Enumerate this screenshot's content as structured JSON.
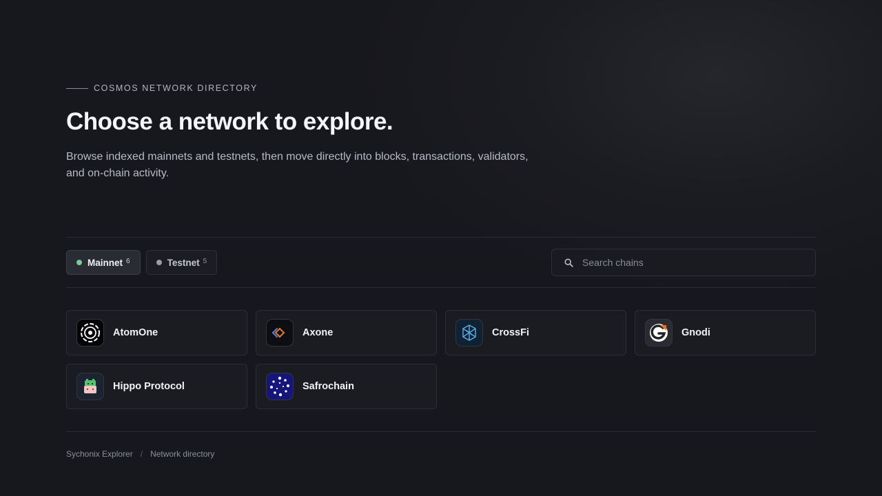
{
  "header": {
    "eyebrow": "COSMOS NETWORK DIRECTORY",
    "title": "Choose a network to explore.",
    "description": "Browse indexed mainnets and testnets, then move directly into blocks, transactions, validators, and on-chain activity."
  },
  "tabs": [
    {
      "label": "Mainnet",
      "count": "6",
      "dot_color": "#7fc79a",
      "active": true
    },
    {
      "label": "Testnet",
      "count": "5",
      "dot_color": "#9a9dae",
      "active": false
    }
  ],
  "search": {
    "placeholder": "Search chains",
    "value": ""
  },
  "chains": [
    {
      "name": "AtomOne",
      "icon": "atomone-logo-icon"
    },
    {
      "name": "Axone",
      "icon": "axone-logo-icon"
    },
    {
      "name": "CrossFi",
      "icon": "crossfi-logo-icon"
    },
    {
      "name": "Gnodi",
      "icon": "gnodi-logo-icon"
    },
    {
      "name": "Hippo Protocol",
      "icon": "hippo-logo-icon"
    },
    {
      "name": "Safrochain",
      "icon": "safrochain-logo-icon"
    }
  ],
  "footer": {
    "breadcrumb": [
      "Sychonix Explorer",
      "Network directory"
    ]
  },
  "colors": {
    "background": "#17181d",
    "card": "#1b1c22",
    "border": "#2c2e35",
    "mainnet_dot": "#7fc79a"
  }
}
